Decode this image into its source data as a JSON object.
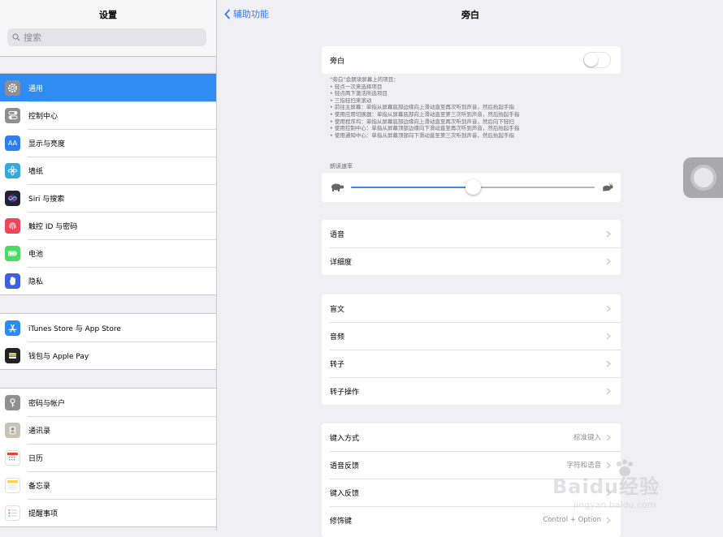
{
  "sidebar": {
    "title": "设置",
    "search_placeholder": "搜索",
    "groups": [
      [
        {
          "label": "通用",
          "icon": "gear-icon",
          "color": "#8e8e93",
          "active": true
        },
        {
          "label": "控制中心",
          "icon": "switches-icon",
          "color": "#8e8e93"
        },
        {
          "label": "显示与亮度",
          "icon": "aa-icon",
          "color": "#2f7cf6"
        },
        {
          "label": "墙纸",
          "icon": "flower-icon",
          "color": "#33aadd"
        },
        {
          "label": "Siri 与搜索",
          "icon": "siri-icon",
          "color": "#222233"
        },
        {
          "label": "触控 ID 与密码",
          "icon": "fingerprint-icon",
          "color": "#f0465a"
        },
        {
          "label": "电池",
          "icon": "battery-icon",
          "color": "#4cd964"
        },
        {
          "label": "隐私",
          "icon": "hand-icon",
          "color": "#3d5fe0"
        }
      ],
      [
        {
          "label": "iTunes Store 与 App Store",
          "icon": "app-store-icon",
          "color": "#2d8cf0"
        },
        {
          "label": "钱包与 Apple Pay",
          "icon": "wallet-icon",
          "color": "#222222"
        }
      ],
      [
        {
          "label": "密码与帐户",
          "icon": "key-icon",
          "color": "#8e8e93"
        },
        {
          "label": "通讯录",
          "icon": "contacts-icon",
          "color": "#c8c2b6"
        },
        {
          "label": "日历",
          "icon": "calendar-icon",
          "color": "#ffffff"
        },
        {
          "label": "备忘录",
          "icon": "notes-icon",
          "color": "#ffffff"
        },
        {
          "label": "提醒事项",
          "icon": "reminders-icon",
          "color": "#ffffff"
        }
      ]
    ]
  },
  "nav": {
    "back_label": "辅助功能",
    "title": "旁白"
  },
  "voiceover": {
    "toggle_label": "旁白",
    "toggle_on": false,
    "description": [
      "“旁白”会朗读屏幕上的项目：",
      "• 轻点一次来选择项目",
      "• 轻点两下激活所选项目",
      "• 三指轻扫来滚动",
      "• 前往主屏幕：单指从屏幕底部边缘向上滑动直至再次听到声音，然后抬起手指",
      "• 使用应用切换器：单指从屏幕底部向上滑动直至第三次听到声音，然后抬起手指",
      "• 使用程序坞：单指从屏幕底部边缘向上滑动直至再次听到声音，然后向下轻扫",
      "• 使用控制中心：单指从屏幕顶部边缘向下滑动直至再次听到声音，然后抬起手指",
      "• 使用通知中心：单指从屏幕顶部向下滑动直至第三次听到声音，然后抬起手指"
    ]
  },
  "speaking_rate": {
    "label": "朗读速率",
    "value": 0.5
  },
  "groups": [
    [
      {
        "label": "语音"
      },
      {
        "label": "详细度"
      }
    ],
    [
      {
        "label": "盲文"
      },
      {
        "label": "音频"
      },
      {
        "label": "转子"
      },
      {
        "label": "转子操作"
      }
    ],
    [
      {
        "label": "键入方式",
        "value": "标准键入"
      },
      {
        "label": "语音反馈",
        "value": "字符和语音"
      },
      {
        "label": "键入反馈",
        "value": ""
      },
      {
        "label": "修饰键",
        "value": "Control + Option"
      }
    ]
  ],
  "watermark": {
    "brand": "Baidu经验",
    "url": "jingyan.baidu.com"
  },
  "colors": {
    "accent": "#2f8cf2",
    "link": "#2f7cf6"
  }
}
